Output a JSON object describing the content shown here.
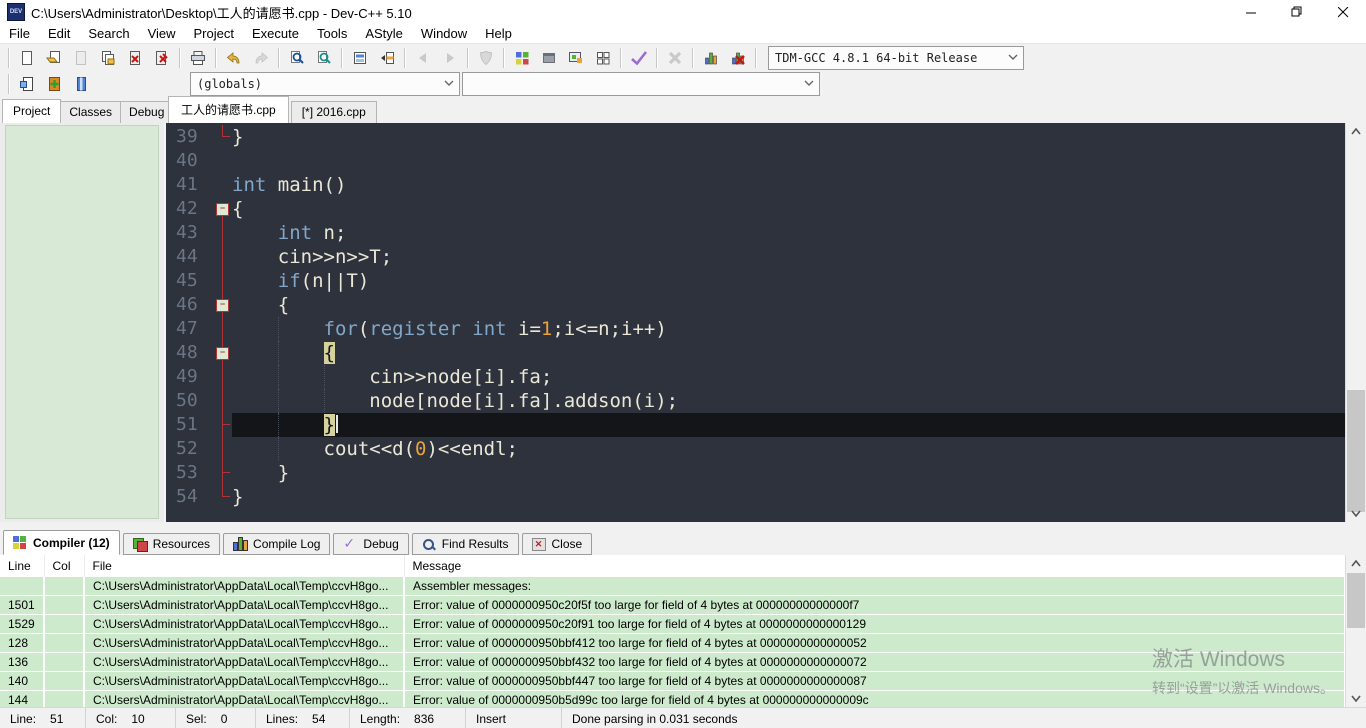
{
  "window": {
    "title": "C:\\Users\\Administrator\\Desktop\\工人的请愿书.cpp - Dev-C++ 5.10"
  },
  "menu": {
    "items": [
      "File",
      "Edit",
      "Search",
      "View",
      "Project",
      "Execute",
      "Tools",
      "AStyle",
      "Window",
      "Help"
    ]
  },
  "toolbar": {
    "compiler_combo": "TDM-GCC 4.8.1 64-bit Release",
    "globals_combo": "(globals)",
    "member_combo": ""
  },
  "left_tabs": [
    "Project",
    "Classes",
    "Debug"
  ],
  "file_tabs": [
    "工人的请愿书.cpp",
    "[*] 2016.cpp"
  ],
  "editor": {
    "lines": [
      {
        "num": "39",
        "rail": "corner",
        "segs": [
          [
            "}",
            "p"
          ]
        ]
      },
      {
        "num": "40",
        "rail": "",
        "segs": []
      },
      {
        "num": "41",
        "rail": "",
        "segs": [
          [
            "int",
            "k"
          ],
          [
            " main()",
            "p"
          ]
        ]
      },
      {
        "num": "42",
        "rail": "fold-start",
        "segs": [
          [
            "{",
            "p"
          ]
        ]
      },
      {
        "num": "43",
        "rail": "line",
        "segs": [
          [
            "    ",
            "p"
          ],
          [
            "int",
            "k"
          ],
          [
            " n;",
            "p"
          ]
        ]
      },
      {
        "num": "44",
        "rail": "line",
        "segs": [
          [
            "    cin>>n>>T;",
            "p"
          ]
        ]
      },
      {
        "num": "45",
        "rail": "line",
        "segs": [
          [
            "    ",
            "p"
          ],
          [
            "if",
            "k"
          ],
          [
            "(n||T)",
            "p"
          ]
        ]
      },
      {
        "num": "46",
        "rail": "fold",
        "segs": [
          [
            "    {",
            "p"
          ]
        ]
      },
      {
        "num": "47",
        "rail": "line",
        "guides": [
          4
        ],
        "segs": [
          [
            "        ",
            "p"
          ],
          [
            "for",
            "k"
          ],
          [
            "(",
            "p"
          ],
          [
            "register",
            "k"
          ],
          [
            " ",
            "p"
          ],
          [
            "int",
            "k"
          ],
          [
            " i=",
            "p"
          ],
          [
            "1",
            "n"
          ],
          [
            ";i<=n;i++)",
            "p"
          ]
        ]
      },
      {
        "num": "48",
        "rail": "fold",
        "guides": [
          4
        ],
        "segs": [
          [
            "        ",
            "p"
          ],
          [
            "{",
            "bm"
          ]
        ]
      },
      {
        "num": "49",
        "rail": "line",
        "guides": [
          4,
          8
        ],
        "segs": [
          [
            "            cin>>node[i].fa;",
            "p"
          ]
        ]
      },
      {
        "num": "50",
        "rail": "line",
        "guides": [
          4,
          8
        ],
        "segs": [
          [
            "            node[node[i].fa].addson(i);",
            "p"
          ]
        ]
      },
      {
        "num": "51",
        "rail": "end",
        "guides": [
          4
        ],
        "current": true,
        "caret": true,
        "segs": [
          [
            "        ",
            "p"
          ],
          [
            "}",
            "bm"
          ]
        ]
      },
      {
        "num": "52",
        "rail": "line",
        "guides": [
          4
        ],
        "segs": [
          [
            "        cout<<d(",
            "p"
          ],
          [
            "0",
            "n"
          ],
          [
            ")<<endl;",
            "p"
          ]
        ]
      },
      {
        "num": "53",
        "rail": "end",
        "segs": [
          [
            "    }",
            "p"
          ]
        ]
      },
      {
        "num": "54",
        "rail": "corner",
        "segs": [
          [
            "}",
            "p"
          ]
        ]
      }
    ]
  },
  "bottom_tabs": [
    {
      "label": "Compiler (12)",
      "icon": "compiler",
      "active": true
    },
    {
      "label": "Resources",
      "icon": "resources"
    },
    {
      "label": "Compile Log",
      "icon": "log"
    },
    {
      "label": "Debug",
      "icon": "debug"
    },
    {
      "label": "Find Results",
      "icon": "find"
    },
    {
      "label": "Close",
      "icon": "close"
    }
  ],
  "compiler": {
    "columns": [
      "Line",
      "Col",
      "File",
      "Message"
    ],
    "rows": [
      {
        "line": "",
        "col": "",
        "file": "C:\\Users\\Administrator\\AppData\\Local\\Temp\\ccvH8go...",
        "message": "Assembler messages:"
      },
      {
        "line": "1501",
        "col": "",
        "file": "C:\\Users\\Administrator\\AppData\\Local\\Temp\\ccvH8go...",
        "message": "Error: value of 0000000950c20f5f too large for field of 4 bytes at 00000000000000f7"
      },
      {
        "line": "1529",
        "col": "",
        "file": "C:\\Users\\Administrator\\AppData\\Local\\Temp\\ccvH8go...",
        "message": "Error: value of 0000000950c20f91 too large for field of 4 bytes at 0000000000000129"
      },
      {
        "line": "128",
        "col": "",
        "file": "C:\\Users\\Administrator\\AppData\\Local\\Temp\\ccvH8go...",
        "message": "Error: value of 0000000950bbf412 too large for field of 4 bytes at 0000000000000052"
      },
      {
        "line": "136",
        "col": "",
        "file": "C:\\Users\\Administrator\\AppData\\Local\\Temp\\ccvH8go...",
        "message": "Error: value of 0000000950bbf432 too large for field of 4 bytes at 0000000000000072"
      },
      {
        "line": "140",
        "col": "",
        "file": "C:\\Users\\Administrator\\AppData\\Local\\Temp\\ccvH8go...",
        "message": "Error: value of 0000000950bbf447 too large for field of 4 bytes at 0000000000000087"
      },
      {
        "line": "144",
        "col": "",
        "file": "C:\\Users\\Administrator\\AppData\\Local\\Temp\\ccvH8go...",
        "message": "Error: value of 0000000950b5d99c too large for field of 4 bytes at 000000000000009c"
      }
    ]
  },
  "status": {
    "sections": [
      {
        "l": "Line:",
        "v": "51"
      },
      {
        "l": "Col:",
        "v": "10"
      },
      {
        "l": "Sel:",
        "v": "0"
      },
      {
        "l": "Lines:",
        "v": "54"
      },
      {
        "l": "Length:",
        "v": "836"
      },
      {
        "l": "Insert",
        "v": ""
      },
      {
        "l": "Done parsing in 0.031 seconds",
        "v": ""
      }
    ]
  },
  "watermark": {
    "line1": "激活 Windows",
    "line2": "转到“设置”以激活 Windows。"
  }
}
